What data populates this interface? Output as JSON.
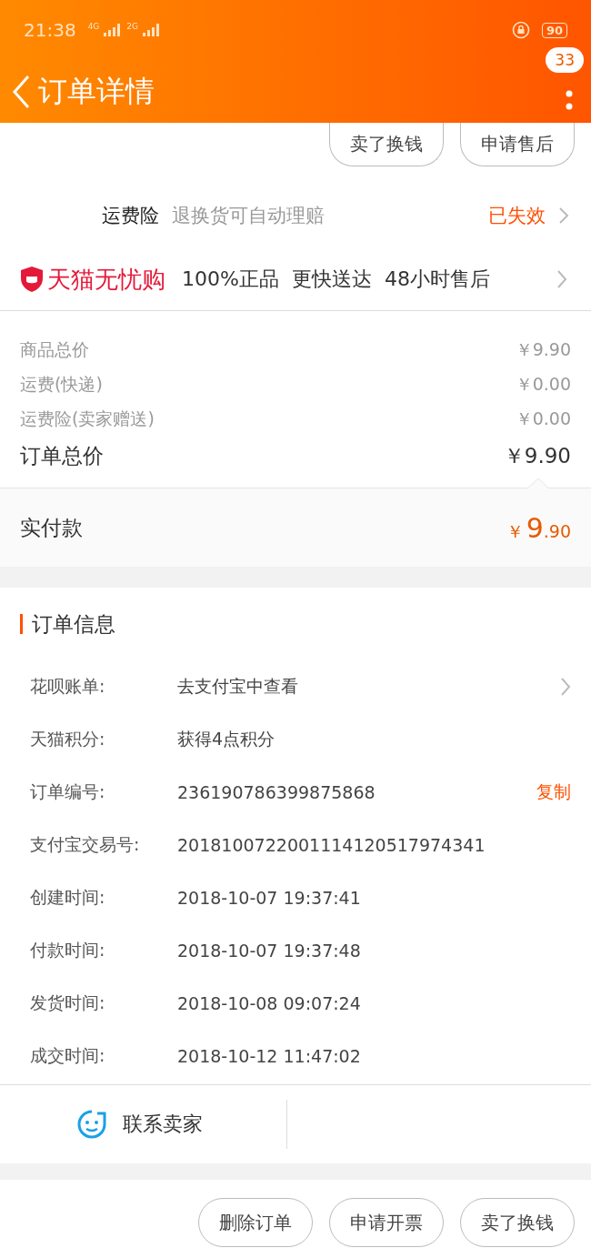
{
  "status_bar": {
    "time": "21:38",
    "net1": "4G",
    "net2": "2G",
    "battery": "90"
  },
  "header": {
    "title": "订单详情",
    "badge": "33"
  },
  "top_actions": [
    "卖了换钱",
    "申请售后"
  ],
  "freight_insurance": {
    "label": "运费险",
    "desc": "退换货可自动理赔",
    "status": "已失效"
  },
  "tmall_guarantee": {
    "brand": "天猫无忧购",
    "features": [
      "100%正品",
      "更快送达",
      "48小时售后"
    ]
  },
  "price_rows": [
    {
      "label": "商品总价",
      "value": "￥9.90"
    },
    {
      "label": "运费(快递)",
      "value": "￥0.00"
    },
    {
      "label": "运费险(卖家赠送)",
      "value": "￥0.00"
    }
  ],
  "order_total": {
    "label": "订单总价",
    "value": "￥9.90"
  },
  "paid": {
    "label": "实付款",
    "currency": "￥",
    "integer": "9",
    "decimal": ".90"
  },
  "order_info": {
    "title": "订单信息",
    "rows": [
      {
        "label": "花呗账单:",
        "value": "去支付宝中查看",
        "kind": "link"
      },
      {
        "label": "天猫积分:",
        "value": "获得4点积分",
        "kind": "plain"
      },
      {
        "label": "订单编号:",
        "value": "236190786399875868",
        "kind": "copy",
        "action": "复制"
      },
      {
        "label": "支付宝交易号:",
        "value": "2018100722001114120517974341",
        "kind": "plain"
      },
      {
        "label": "创建时间:",
        "value": "2018-10-07 19:37:41",
        "kind": "plain"
      },
      {
        "label": "付款时间:",
        "value": "2018-10-07 19:37:48",
        "kind": "plain"
      },
      {
        "label": "发货时间:",
        "value": "2018-10-08 09:07:24",
        "kind": "plain"
      },
      {
        "label": "成交时间:",
        "value": "2018-10-12 11:47:02",
        "kind": "plain"
      }
    ]
  },
  "contact": {
    "label": "联系卖家"
  },
  "bottom_actions": [
    "删除订单",
    "申请开票",
    "卖了换钱"
  ]
}
